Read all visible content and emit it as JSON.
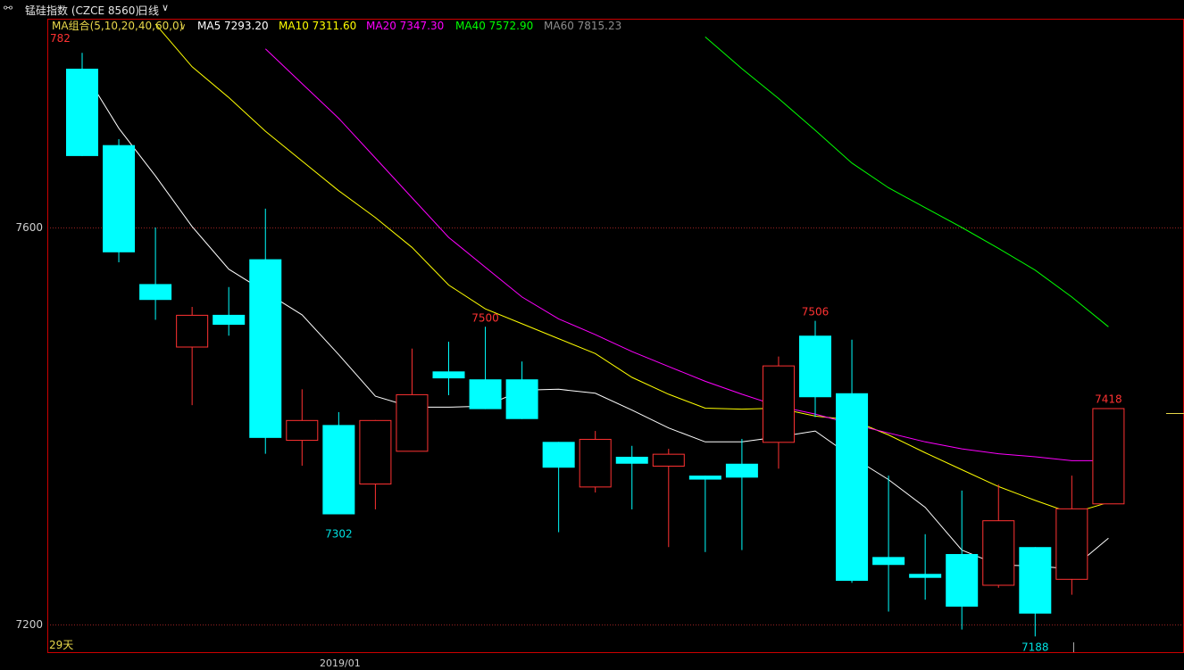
{
  "topbar": {
    "title": "锰硅指数 (CZCE 8560)",
    "period": "日线",
    "link_icon": "link-icon",
    "chevron_icon": "chevron-down-icon"
  },
  "ma_legend": {
    "group_label": "MA组合(5,10,20,40,60,0)",
    "items": [
      {
        "label": "MA5 7293.20",
        "color": "#ffffff"
      },
      {
        "label": "MA10 7311.60",
        "color": "#ffff00"
      },
      {
        "label": "MA20 7347.30",
        "color": "#ff00ff"
      },
      {
        "label": "MA40 7572.90",
        "color": "#00ff00"
      },
      {
        "label": "MA60 7815.23",
        "color": "#8c8c8c"
      }
    ]
  },
  "colors": {
    "up": "#ff3232",
    "down": "#00ffff",
    "axis": "#cc0000",
    "grid": "#992222",
    "label_up": "#ff3232",
    "label_down": "#00e0e0",
    "tick_text": "#cfcfcf"
  },
  "footer": {
    "days_label": "29天",
    "date_label": "2019/01"
  },
  "chart_data": {
    "type": "candlestick",
    "y_ticks": [
      7600,
      7200
    ],
    "ylim": [
      7183,
      7795
    ],
    "candles": [
      {
        "o": 7760,
        "h": 7776,
        "l": 7692,
        "c": 7672
      },
      {
        "o": 7683,
        "h": 7689,
        "l": 7565,
        "c": 7575
      },
      {
        "o": 7543,
        "h": 7600,
        "l": 7507,
        "c": 7527
      },
      {
        "o": 7480,
        "h": 7520,
        "l": 7421,
        "c": 7512
      },
      {
        "o": 7512,
        "h": 7540,
        "l": 7491,
        "c": 7502
      },
      {
        "o": 7568,
        "h": 7619,
        "l": 7372,
        "c": 7388
      },
      {
        "o": 7386,
        "h": 7437,
        "l": 7360,
        "c": 7406
      },
      {
        "o": 7401,
        "h": 7414,
        "l": 7311,
        "c": 7311
      },
      {
        "o": 7342,
        "h": 7366,
        "l": 7316,
        "c": 7406
      },
      {
        "o": 7375,
        "h": 7478,
        "l": 7471,
        "c": 7432
      },
      {
        "o": 7455,
        "h": 7485,
        "l": 7431,
        "c": 7448
      },
      {
        "o": 7447,
        "h": 7500,
        "l": 7417,
        "c": 7417
      },
      {
        "o": 7447,
        "h": 7465,
        "l": 7423,
        "c": 7407
      },
      {
        "o": 7384,
        "h": 7384,
        "l": 7293,
        "c": 7358
      },
      {
        "o": 7339,
        "h": 7395,
        "l": 7333,
        "c": 7387
      },
      {
        "o": 7369,
        "h": 7380,
        "l": 7316,
        "c": 7362
      },
      {
        "o": 7360,
        "h": 7377,
        "l": 7278,
        "c": 7372
      },
      {
        "o": 7350,
        "h": 7348,
        "l": 7273,
        "c": 7346
      },
      {
        "o": 7362,
        "h": 7387,
        "l": 7275,
        "c": 7348
      },
      {
        "o": 7384,
        "h": 7470,
        "l": 7357,
        "c": 7461
      },
      {
        "o": 7491,
        "h": 7506,
        "l": 7409,
        "c": 7429
      },
      {
        "o": 7433,
        "h": 7487,
        "l": 7242,
        "c": 7244
      },
      {
        "o": 7268,
        "h": 7350,
        "l": 7213,
        "c": 7260
      },
      {
        "o": 7251,
        "h": 7291,
        "l": 7225,
        "c": 7247
      },
      {
        "o": 7271,
        "h": 7335,
        "l": 7195,
        "c": 7218
      },
      {
        "o": 7240,
        "h": 7341,
        "l": 7237,
        "c": 7305
      },
      {
        "o": 7278,
        "h": 7244,
        "l": 7188,
        "c": 7211
      },
      {
        "o": 7246,
        "h": 7350,
        "l": 7230,
        "c": 7317
      },
      {
        "o": 7322,
        "h": 7418,
        "l": 7325,
        "c": 7418
      }
    ],
    "price_labels": [
      {
        "text": "782",
        "index": 0,
        "value": 7782,
        "kind": "up"
      },
      {
        "text": "7302",
        "index": 7,
        "value": 7302,
        "kind": "down"
      },
      {
        "text": "7500",
        "index": 11,
        "value": 7500,
        "kind": "up"
      },
      {
        "text": "7506",
        "index": 20,
        "value": 7506,
        "kind": "up"
      },
      {
        "text": "7418",
        "index": 28,
        "value": 7418,
        "kind": "up"
      },
      {
        "text": "7188",
        "index": 26,
        "value": 7188,
        "kind": "down"
      }
    ],
    "ma_lines": [
      {
        "name": "MA5",
        "color": "#ffffff",
        "values": [
          7760,
          7700,
          7652,
          7601,
          7558,
          7535,
          7512,
          7472,
          7430,
          7419,
          7419,
          7420,
          7436,
          7437,
          7433,
          7416,
          7398,
          7384,
          7384,
          7389,
          7395,
          7369,
          7346,
          7318,
          7275,
          7260,
          7259,
          7256,
          7287
        ]
      },
      {
        "name": "MA10",
        "color": "#ffff00",
        "values": [
          7870,
          7836,
          7805,
          7762,
          7731,
          7697,
          7667,
          7637,
          7610,
          7580,
          7542,
          7518,
          7503,
          7488,
          7473,
          7449,
          7432,
          7418,
          7417,
          7418,
          7410,
          7406,
          7391,
          7373,
          7356,
          7339,
          7325,
          7312,
          7323
        ]
      },
      {
        "name": "MA20",
        "color": "#ff00ff",
        "values": [
          7955,
          7920,
          7885,
          7850,
          7815,
          7780,
          7745,
          7710,
          7670,
          7630,
          7590,
          7560,
          7530,
          7508,
          7492,
          7475,
          7460,
          7445,
          7432,
          7420,
          7412,
          7402,
          7393,
          7384,
          7377,
          7372,
          7369,
          7365,
          7365
        ]
      },
      {
        "name": "MA40",
        "color": "#00ff00",
        "values": [
          null,
          null,
          null,
          null,
          null,
          null,
          null,
          null,
          null,
          null,
          null,
          null,
          null,
          null,
          null,
          null,
          null,
          7792,
          7760,
          7730,
          7698,
          7665,
          7640,
          7620,
          7600,
          7579,
          7557,
          7530,
          7500
        ]
      },
      {
        "name": "MA60",
        "color": "#8c8c8c",
        "values": []
      }
    ]
  }
}
